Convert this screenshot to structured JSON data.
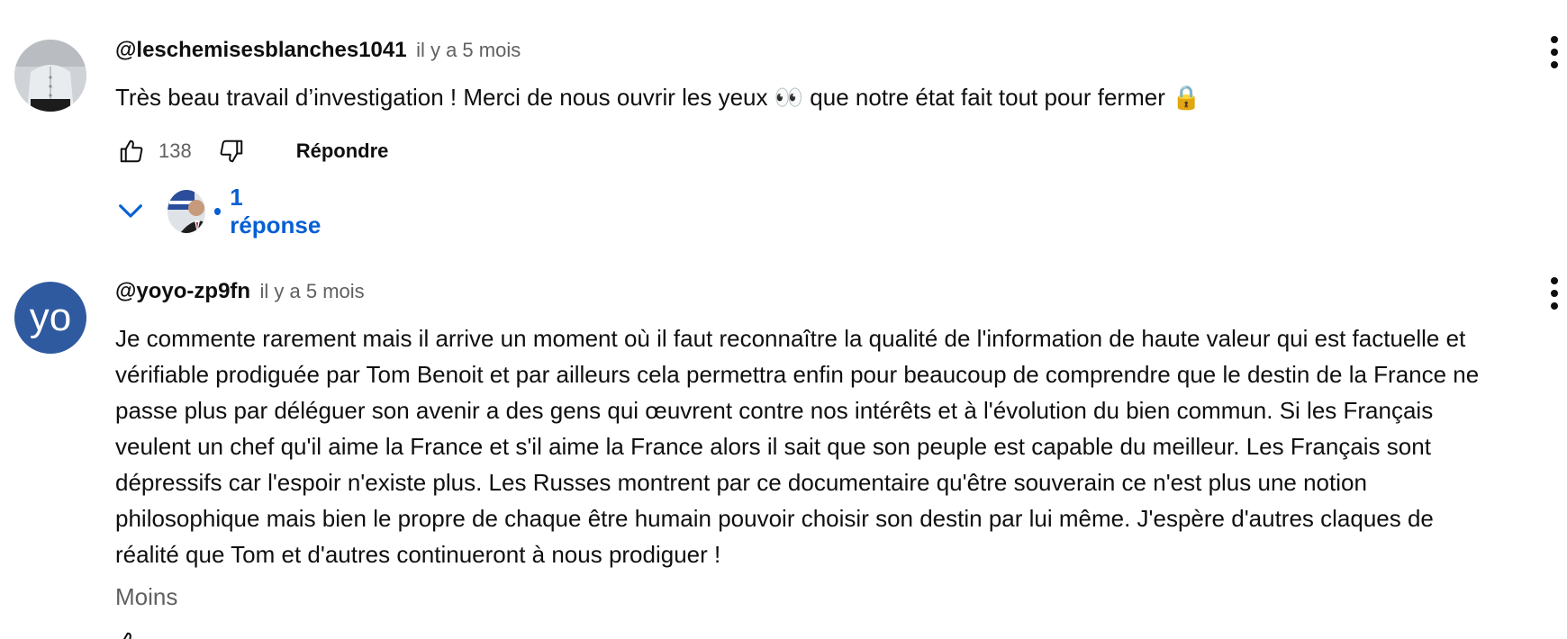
{
  "comments": [
    {
      "author": "@leschemisesblanches1041",
      "time": "il y a 5 mois",
      "text": "Très beau travail d’investigation ! Merci de nous ouvrir les yeux 👀 que notre état fait tout pour fermer 🔒",
      "likes": "138",
      "reply_label": "Répondre",
      "replies_label": "1 réponse"
    },
    {
      "author": "@yoyo-zp9fn",
      "time": "il y a 5 mois",
      "avatar_letters": "yo",
      "lines": [
        "Je commente rarement mais il arrive un moment où il faut reconnaître la qualité de l'information de haute valeur qui est factuelle et",
        "vérifiable prodiguée par Tom Benoit et par ailleurs cela permettra enfin pour beaucoup de comprendre que le destin de la France ne",
        "passe plus par déléguer son avenir a des gens qui œuvrent contre nos intérêts et à l'évolution du bien commun. Si les Français",
        "veulent un chef qu'il aime la France et s'il aime la France alors il sait que son peuple est capable du meilleur. Les Français sont",
        "dépressifs car l'espoir n'existe plus. Les Russes montrent par ce documentaire qu'être souverain ce n'est plus une notion",
        "philosophique mais bien le propre de chaque être humain pouvoir choisir son destin par lui même. J'espère d'autres claques de",
        "réalité que Tom et d'autres continueront à nous prodiguer !"
      ],
      "less_label": "Moins"
    }
  ],
  "colors": {
    "link_blue": "#065fd4",
    "secondary_text": "#606060",
    "avatar_blue": "#2f5aa0"
  },
  "icons": [
    "thumbs-up-icon",
    "thumbs-down-icon",
    "chevron-down-icon",
    "more-vert-icon"
  ]
}
